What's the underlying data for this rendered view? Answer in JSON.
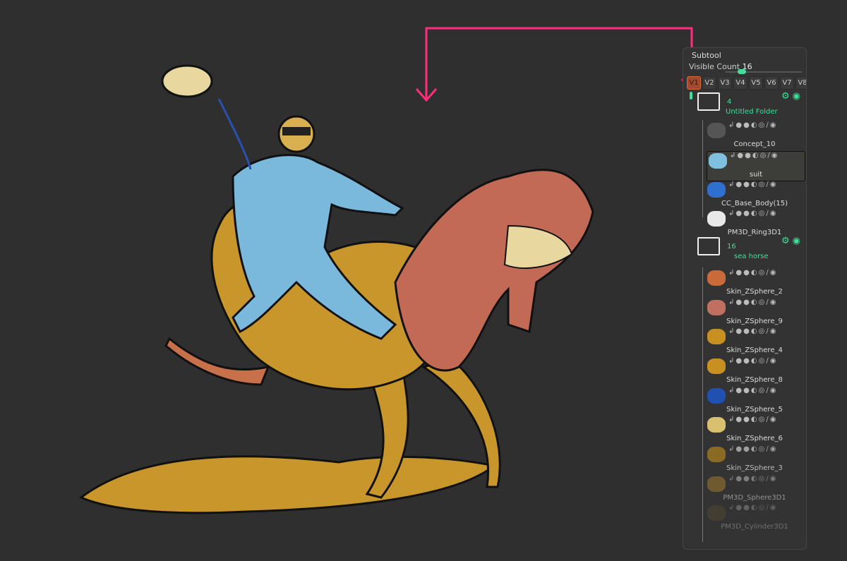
{
  "subtool_panel": {
    "title": "Subtool",
    "visible_count_label": "Visible Count",
    "visible_count": "16",
    "slider_fraction": 0.16,
    "version_buttons": [
      "V1",
      "V2",
      "V3",
      "V4",
      "V5",
      "V6",
      "V7",
      "V8"
    ],
    "active_version": "V1",
    "folders": [
      {
        "name": "Untitled Folder",
        "count": "4"
      },
      {
        "name": "sea horse",
        "count": "16"
      }
    ],
    "items": [
      {
        "name": "Concept_10",
        "color": "#555555",
        "opacity": 1
      },
      {
        "name": "suit",
        "color": "#7fc0e0",
        "opacity": 1,
        "selected": true
      },
      {
        "name": "CC_Base_Body(15)",
        "color": "#2f6fd0",
        "opacity": 1
      },
      {
        "name": "PM3D_Ring3D1",
        "color": "#e8e8e8",
        "opacity": 1
      },
      {
        "name": "Skin_ZSphere_2",
        "color": "#c86a3a",
        "opacity": 1
      },
      {
        "name": "Skin_ZSphere_9",
        "color": "#c07060",
        "opacity": 1
      },
      {
        "name": "Skin_ZSphere_4",
        "color": "#c89020",
        "opacity": 1
      },
      {
        "name": "Skin_ZSphere_8",
        "color": "#c89020",
        "opacity": 1
      },
      {
        "name": "Skin_ZSphere_5",
        "color": "#2050b0",
        "opacity": 1
      },
      {
        "name": "Skin_ZSphere_6",
        "color": "#d8c070",
        "opacity": 1
      },
      {
        "name": "Skin_ZSphere_3",
        "color": "#a07820",
        "opacity": 0.8
      },
      {
        "name": "PM3D_Sphere3D1",
        "color": "#a07830",
        "opacity": 0.55
      },
      {
        "name": "PM3D_Cylinder3D1",
        "color": "#605030",
        "opacity": 0.35
      }
    ]
  },
  "colors": {
    "accent": "#3ee09a",
    "arrow": "#ff2d7a",
    "active_version": "#a8482a"
  }
}
